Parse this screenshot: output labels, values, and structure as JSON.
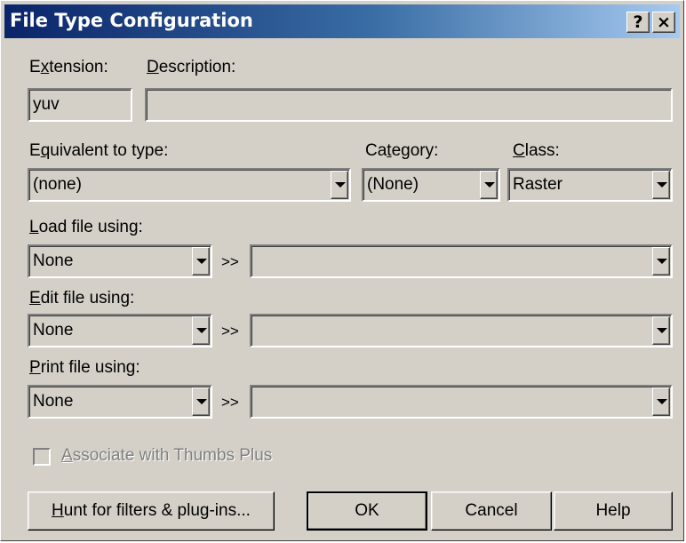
{
  "window": {
    "title": "File Type Configuration",
    "help_button": "?",
    "close_button": "×"
  },
  "extension": {
    "label_pre": "E",
    "label_accel": "x",
    "label_post": "tension:",
    "value": "yuv"
  },
  "description": {
    "label_accel": "D",
    "label_post": "escription:",
    "value": ""
  },
  "equivalent": {
    "label_pre": "E",
    "label_accel": "q",
    "label_post": "uivalent to type:",
    "value": "(none)"
  },
  "category": {
    "label_pre": "Ca",
    "label_accel": "t",
    "label_post": "egory:",
    "value": "(None)"
  },
  "class": {
    "label_accel": "C",
    "label_post": "lass:",
    "value": "Raster"
  },
  "load": {
    "label_accel": "L",
    "label_post": "oad file using:",
    "value": "None",
    "separator": ">>",
    "target": ""
  },
  "edit": {
    "label_accel": "E",
    "label_post": "dit file using:",
    "value": "None",
    "separator": ">>",
    "target": ""
  },
  "print": {
    "label_accel": "P",
    "label_post": "rint file using:",
    "value": "None",
    "separator": ">>",
    "target": ""
  },
  "associate": {
    "label_accel": "A",
    "label_post": "ssociate with Thumbs Plus",
    "checked": false,
    "enabled": false
  },
  "buttons": {
    "hunt_accel": "H",
    "hunt_post": "unt for filters & plug-ins...",
    "ok": "OK",
    "cancel": "Cancel",
    "help": "Help"
  }
}
